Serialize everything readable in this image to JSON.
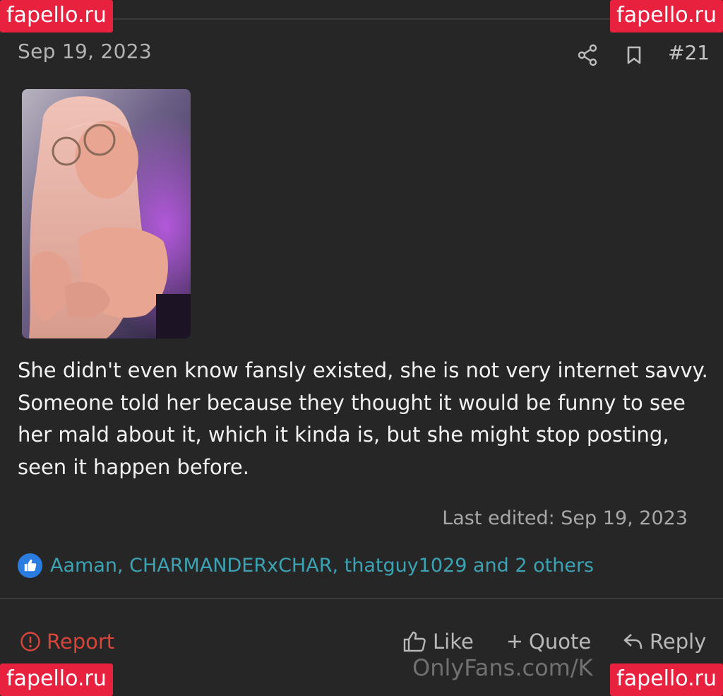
{
  "post": {
    "date": "Sep 19, 2023",
    "number": "#21",
    "message": "She didn't even know fansly existed, she is not very internet savvy. Someone told her because they thought it would be funny to see her mald about it, which it kinda is, but she might stop posting, seen it happen before.",
    "last_edited": "Last edited: Sep 19, 2023"
  },
  "reactions": {
    "text": "Aaman, CHARMANDERxCHAR, thatguy1029 and 2 others"
  },
  "actions": {
    "report": "Report",
    "like": "Like",
    "quote": "Quote",
    "reply": "Reply"
  },
  "watermarks": {
    "badge_tl": "fapello.ru",
    "badge_tr": "fapello.ru",
    "badge_bl": "fapello.ru",
    "badge_br": "fapello.ru",
    "bottom": "OnlyFans.com/K"
  },
  "icons": {
    "share": "share-icon",
    "bookmark": "bookmark-icon",
    "report": "alert-circle-icon",
    "like": "thumbs-up-icon",
    "quote": "plus-icon",
    "reply": "reply-arrow-icon"
  },
  "colors": {
    "background": "#262626",
    "link": "#3ba3b3",
    "report": "#d6453a",
    "like_bubble": "#2a7ce0",
    "badge": "#e8213f"
  }
}
